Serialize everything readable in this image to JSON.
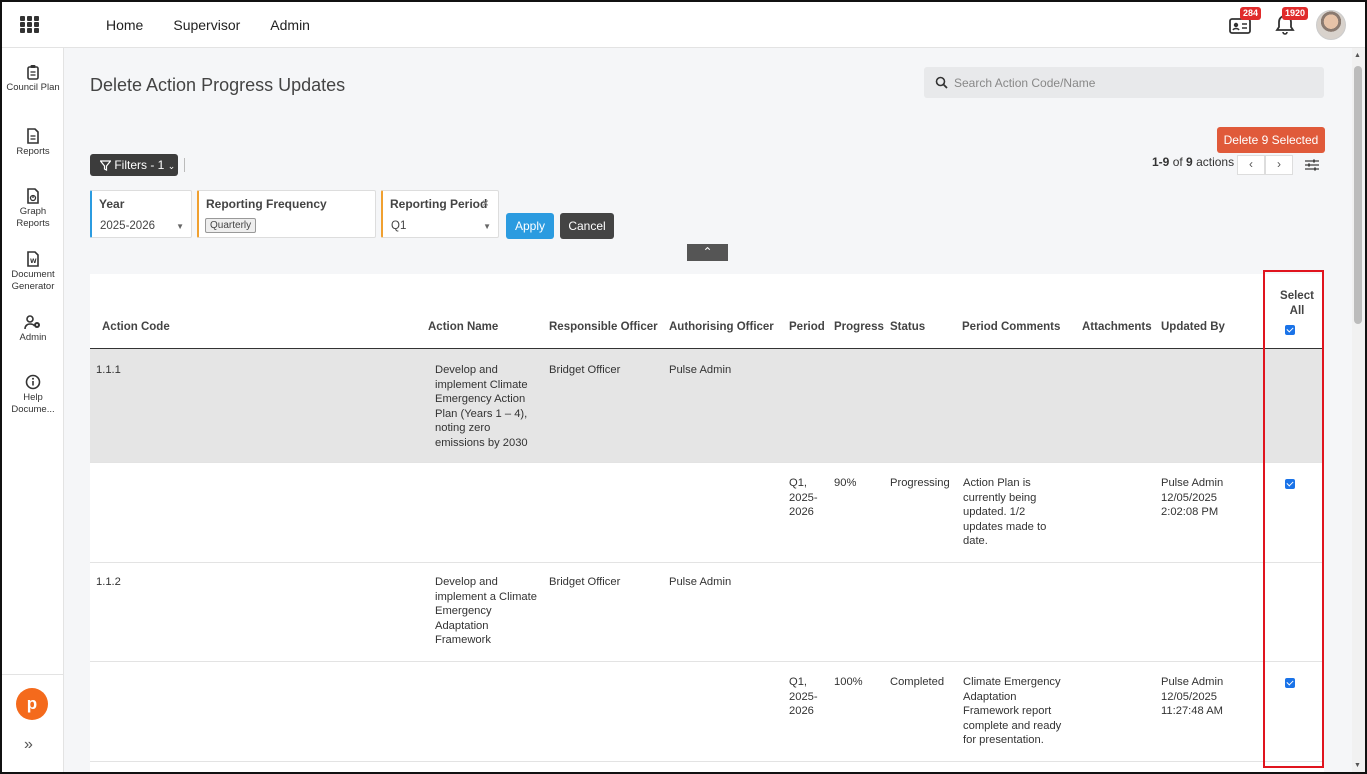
{
  "topbar": {
    "nav": [
      "Home",
      "Supervisor",
      "Admin"
    ],
    "messages_badge": "284",
    "notifications_badge": "1920"
  },
  "sidebar": {
    "items": [
      {
        "label": "Council Plan",
        "icon": "clipboard-icon"
      },
      {
        "label": "Reports",
        "icon": "document-icon"
      },
      {
        "label": "Graph Reports",
        "icon": "chart-document-icon"
      },
      {
        "label": "Document Generator",
        "icon": "word-document-icon"
      },
      {
        "label": "Admin",
        "icon": "user-gear-icon"
      },
      {
        "label": "Help Docume...",
        "icon": "info-icon"
      }
    ],
    "logo_letter": "p"
  },
  "page": {
    "title": "Delete Action Progress Updates",
    "search_placeholder": "Search Action Code/Name",
    "delete_button": "Delete 9 Selected",
    "filters_button": "Filters - 1",
    "pager": {
      "range": "1-9",
      "of": "of",
      "total": "9",
      "unit": "actions"
    }
  },
  "filters": {
    "year": {
      "label": "Year",
      "value": "2025-2026"
    },
    "reporting_frequency": {
      "label": "Reporting Frequency",
      "value": "Quarterly"
    },
    "reporting_period": {
      "label": "Reporting Period",
      "value": "Q1"
    },
    "apply": "Apply",
    "cancel": "Cancel"
  },
  "table": {
    "headers": {
      "action_code": "Action Code",
      "action_name": "Action Name",
      "responsible_officer": "Responsible Officer",
      "authorising_officer": "Authorising Officer",
      "period": "Period",
      "progress": "Progress",
      "status": "Status",
      "period_comments": "Period Comments",
      "attachments": "Attachments",
      "updated_by": "Updated By",
      "select_all": "Select All"
    },
    "actions": [
      {
        "code": "1.1.1",
        "name": "Develop and implement Climate Emergency Action Plan (Years 1 – 4), noting zero emissions by 2030",
        "responsible": "Bridget Officer",
        "authorising": "Pulse Admin",
        "update": {
          "period": "Q1, 2025-2026",
          "progress": "90%",
          "status": "Progressing",
          "comments": "Action Plan is currently being updated. 1/2 updates made to date.",
          "updated_by": "Pulse Admin 12/05/2025 2:02:08 PM",
          "selected": true
        }
      },
      {
        "code": "1.1.2",
        "name": "Develop and implement a Climate Emergency Adaptation Framework",
        "responsible": "Bridget Officer",
        "authorising": "Pulse Admin",
        "update": {
          "period": "Q1, 2025-2026",
          "progress": "100%",
          "status": "Completed",
          "comments": "Climate Emergency Adaptation Framework report complete and ready for presentation.",
          "updated_by": "Pulse Admin 12/05/2025 11:27:48 AM",
          "selected": true
        }
      }
    ]
  },
  "colors": {
    "delete": "#e05a3a",
    "apply": "#2b9be0",
    "highlight_box": "#e0141e",
    "badge": "#e02b2b",
    "logo": "#f46a1c"
  }
}
